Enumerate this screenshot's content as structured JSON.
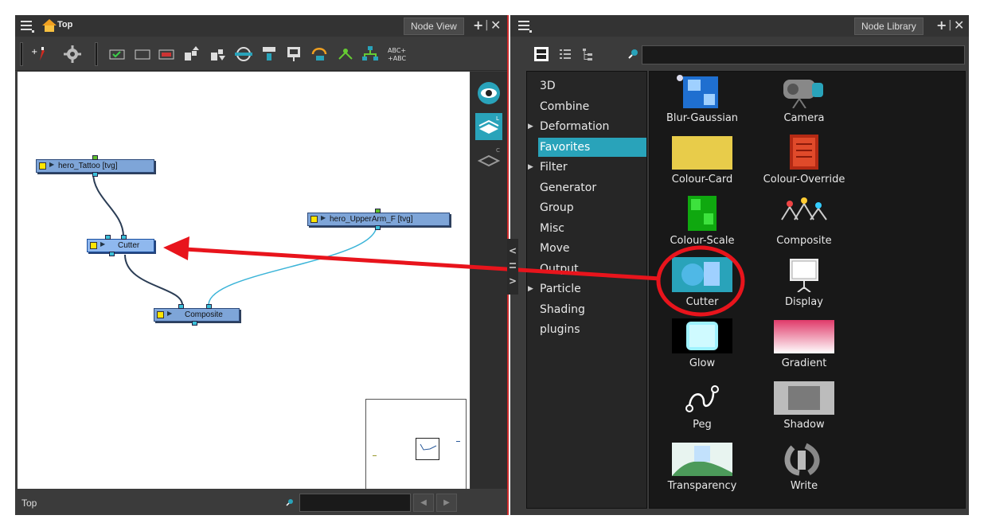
{
  "node_view": {
    "breadcrumb": "Top",
    "tab_label": "Node View",
    "status_label": "Top",
    "search_value": "",
    "nodes": {
      "tattoo": "hero_Tattoo [tvg]",
      "upperarm": "hero_UpperArm_F [tvg]",
      "cutter": "Cutter",
      "composite": "Composite"
    },
    "toolbar": {
      "abc_label": "ABC+\n+ABC"
    }
  },
  "node_library": {
    "tab_label": "Node Library",
    "search_value": "",
    "categories": [
      {
        "label": "3D",
        "expandable": false
      },
      {
        "label": "Combine",
        "expandable": false
      },
      {
        "label": "Deformation",
        "expandable": true
      },
      {
        "label": "Favorites",
        "expandable": false,
        "selected": true
      },
      {
        "label": "Filter",
        "expandable": true
      },
      {
        "label": "Generator",
        "expandable": false
      },
      {
        "label": "Group",
        "expandable": false
      },
      {
        "label": "Misc",
        "expandable": false
      },
      {
        "label": "Move",
        "expandable": false
      },
      {
        "label": "Output",
        "expandable": false
      },
      {
        "label": "Particle",
        "expandable": true
      },
      {
        "label": "Shading",
        "expandable": false
      },
      {
        "label": "plugins",
        "expandable": false
      }
    ],
    "items": [
      {
        "label": "Blur-Gaussian",
        "icon": "blur-gaussian-icon"
      },
      {
        "label": "Camera",
        "icon": "camera-icon"
      },
      {
        "label": "Colour-Card",
        "icon": "colour-card-icon"
      },
      {
        "label": "Colour-Override",
        "icon": "colour-override-icon"
      },
      {
        "label": "Colour-Scale",
        "icon": "colour-scale-icon"
      },
      {
        "label": "Composite",
        "icon": "composite-icon"
      },
      {
        "label": "Cutter",
        "icon": "cutter-icon"
      },
      {
        "label": "Display",
        "icon": "display-icon"
      },
      {
        "label": "Glow",
        "icon": "glow-icon"
      },
      {
        "label": "Gradient",
        "icon": "gradient-icon"
      },
      {
        "label": "Peg",
        "icon": "peg-icon"
      },
      {
        "label": "Shadow",
        "icon": "shadow-icon"
      },
      {
        "label": "Transparency",
        "icon": "transparency-icon"
      },
      {
        "label": "Write",
        "icon": "write-icon"
      }
    ]
  },
  "colors": {
    "panel_bg": "#3b3b3b",
    "selection": "#29a3ba",
    "annotation_red": "#e8141c",
    "node_blue": "#7ea5d8"
  }
}
